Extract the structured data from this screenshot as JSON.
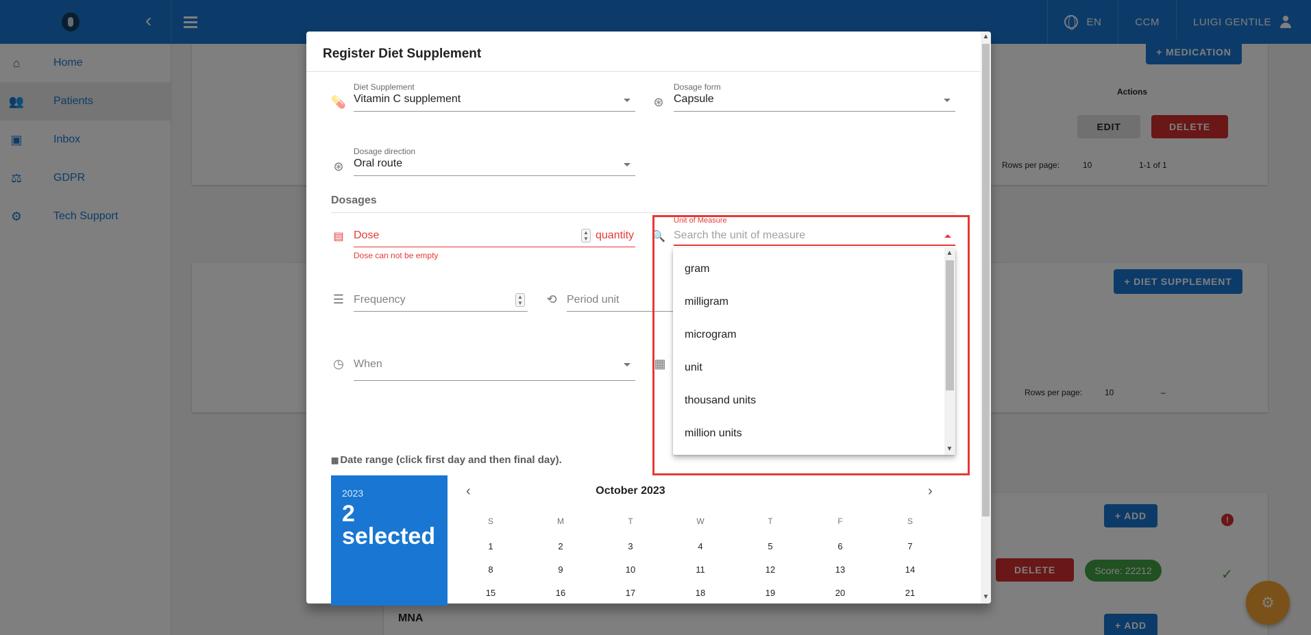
{
  "topbar": {
    "language": "EN",
    "ccm": "CCM",
    "user": "LUIGI GENTILE"
  },
  "sidebar": {
    "items": [
      {
        "label": "Home",
        "icon": "home-icon"
      },
      {
        "label": "Patients",
        "icon": "people-icon"
      },
      {
        "label": "Inbox",
        "icon": "inbox-icon"
      },
      {
        "label": "GDPR",
        "icon": "gavel-icon"
      },
      {
        "label": "Tech Support",
        "icon": "support-icon"
      }
    ]
  },
  "background": {
    "medication_button": "+ MEDICATION",
    "actions_header": "Actions",
    "edit_button": "EDIT",
    "delete_button": "DELETE",
    "rows_per_page_label": "Rows per page:",
    "rows_per_page_value": "10",
    "pagination_1": "1-1 of 1",
    "diet_supplement_button": "+ DIET SUPPLEMENT",
    "rows_per_page_label_2": "Rows per page:",
    "rows_per_page_value_2": "10",
    "pagination_2": "–",
    "add_button_1": "+ ADD",
    "delete_button_2": "DELETE",
    "score": "Score: 22212",
    "mna_title": "MNA",
    "add_button_2": "+ ADD"
  },
  "modal": {
    "title": "Register Diet Supplement",
    "diet_supplement": {
      "label": "Diet Supplement",
      "value": "Vitamin C supplement"
    },
    "dosage_form": {
      "label": "Dosage form",
      "value": "Capsule"
    },
    "dosage_direction": {
      "label": "Dosage direction",
      "value": "Oral route"
    },
    "dosages_title": "Dosages",
    "dose": {
      "placeholder": "Dose",
      "unit": "quantity",
      "error": "Dose can not be empty"
    },
    "unit_of_measure": {
      "label": "Unit of Measure",
      "placeholder": "Search the unit of measure"
    },
    "frequency": {
      "placeholder": "Frequency"
    },
    "period_unit": {
      "placeholder": "Period unit"
    },
    "when": {
      "placeholder": "When"
    },
    "date_range_label": "Date range (click first day and then final day).",
    "calendar": {
      "year": "2023",
      "selected": "2 selected",
      "month": "October 2023",
      "weekdays": [
        "S",
        "M",
        "T",
        "W",
        "T",
        "F",
        "S"
      ],
      "weeks": [
        [
          "1",
          "2",
          "3",
          "4",
          "5",
          "6",
          "7"
        ],
        [
          "8",
          "9",
          "10",
          "11",
          "12",
          "13",
          "14"
        ],
        [
          "15",
          "16",
          "17",
          "18",
          "19",
          "20",
          "21"
        ]
      ]
    }
  },
  "dropdown": {
    "options": [
      "gram",
      "milligram",
      "microgram",
      "unit",
      "thousand units",
      "million units"
    ]
  },
  "colors": {
    "primary": "#1976d2",
    "error": "#e53935",
    "delete": "#d32f2f",
    "success": "#43a047",
    "fab": "#f4a231"
  }
}
